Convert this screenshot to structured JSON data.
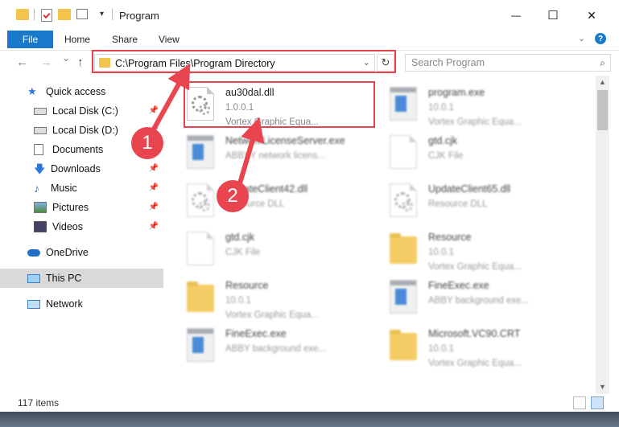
{
  "window": {
    "title": "Program",
    "minimize_glyph": "—",
    "maximize_glyph": "☐",
    "close_glyph": "✕"
  },
  "ribbon": {
    "file": "File",
    "home": "Home",
    "share": "Share",
    "view": "View",
    "help": "?"
  },
  "nav": {
    "back": "←",
    "forward": "→",
    "recent": "⌄",
    "up": "↑",
    "address": "C:\\Program Files\\Program Directory",
    "refresh": "↻",
    "search_placeholder": "Search Program",
    "search_icon": "search-icon"
  },
  "sidebar": {
    "items": [
      {
        "label": "Quick access",
        "icon": "star-icon",
        "pinned": false
      },
      {
        "label": "Local Disk (C:)",
        "icon": "drive-icon",
        "pinned": true
      },
      {
        "label": "Local Disk (D:)",
        "icon": "drive-icon",
        "pinned": true
      },
      {
        "label": "Documents",
        "icon": "documents-icon",
        "pinned": true
      },
      {
        "label": "Downloads",
        "icon": "download-icon",
        "pinned": true
      },
      {
        "label": "Music",
        "icon": "music-icon",
        "pinned": true
      },
      {
        "label": "Pictures",
        "icon": "pictures-icon",
        "pinned": true
      },
      {
        "label": "Videos",
        "icon": "videos-icon",
        "pinned": true
      },
      {
        "label": "OneDrive",
        "icon": "cloud-icon",
        "pinned": false
      },
      {
        "label": "This PC",
        "icon": "computer-icon",
        "pinned": false,
        "selected": true
      },
      {
        "label": "Network",
        "icon": "network-icon",
        "pinned": false
      }
    ]
  },
  "files": [
    {
      "name": "au30dal.dll",
      "line2": "1.0.0.1",
      "line3": "Vortex Graphic Equa...",
      "icon": "dll-gear-icon",
      "highlighted": true
    },
    {
      "name": "program.exe",
      "line2": "10.0.1",
      "line3": "Vortex Graphic Equa...",
      "icon": "exe-icon"
    },
    {
      "name": "NetworkLicenseServer.exe",
      "line2": "ABBYY network licens...",
      "line3": "",
      "icon": "exe-icon"
    },
    {
      "name": "gtd.cjk",
      "line2": "CJK File",
      "line3": "",
      "icon": "document-icon"
    },
    {
      "name": "UpdateClient42.dll",
      "line2": "Resource DLL",
      "line3": "",
      "icon": "dll-gear-icon"
    },
    {
      "name": "UpdateClient65.dll",
      "line2": "Resource DLL",
      "line3": "",
      "icon": "dll-gear-icon"
    },
    {
      "name": "gtd.cjk",
      "line2": "CJK File",
      "line3": "",
      "icon": "document-icon"
    },
    {
      "name": "Resource",
      "line2": "10.0.1",
      "line3": "Vortex Graphic Equa...",
      "icon": "folder-icon"
    },
    {
      "name": "Resource",
      "line2": "10.0.1",
      "line3": "Vortex Graphic Equa...",
      "icon": "folder-icon"
    },
    {
      "name": "FineExec.exe",
      "line2": "ABBY background exe...",
      "line3": "",
      "icon": "exe-icon"
    },
    {
      "name": "FineExec.exe",
      "line2": "ABBY background exe...",
      "line3": "",
      "icon": "exe-icon"
    },
    {
      "name": "Microsoft.VC90.CRT",
      "line2": "10.0.1",
      "line3": "Vortex Graphic Equa...",
      "icon": "folder-icon"
    }
  ],
  "status": {
    "items_count": "117 items"
  },
  "annotations": {
    "step1": "1",
    "step2": "2",
    "color": "#e8454f"
  },
  "colors": {
    "accent": "#1979ca",
    "highlight_red": "#e6434d",
    "selected_bg": "#d9d9d9"
  }
}
